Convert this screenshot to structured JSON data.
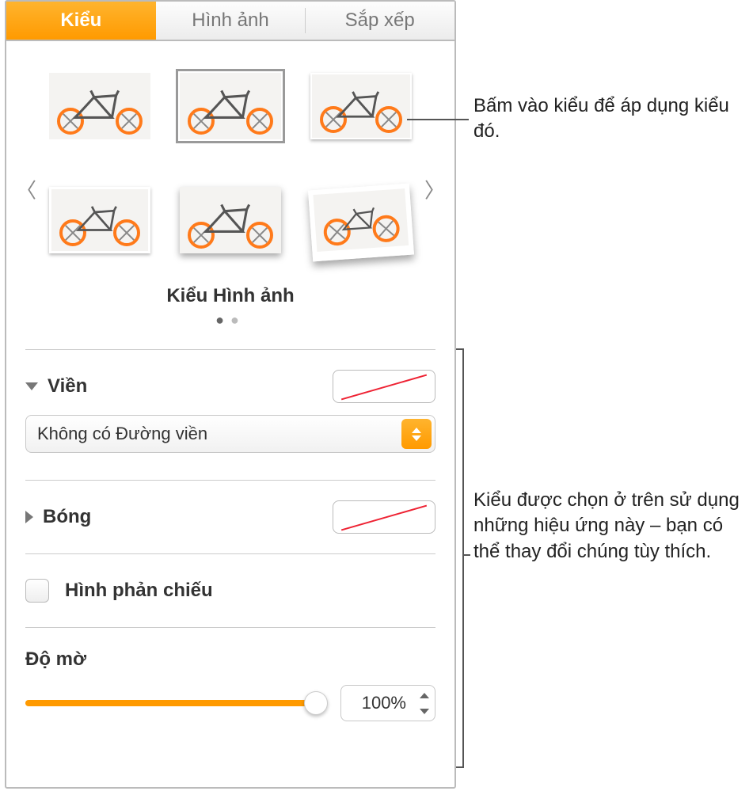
{
  "tabs": {
    "style": "Kiểu",
    "image": "Hình ảnh",
    "arrange": "Sắp xếp"
  },
  "gallery": {
    "title": "Kiểu Hình ảnh"
  },
  "border": {
    "label": "Viền",
    "dropdown": "Không có Đường viền"
  },
  "shadow": {
    "label": "Bóng"
  },
  "reflection": {
    "label": "Hình phản chiếu"
  },
  "opacity": {
    "label": "Độ mờ",
    "value": "100%"
  },
  "callouts": {
    "top": "Bấm vào kiểu để áp dụng kiểu đó.",
    "side": "Kiểu được chọn ở trên sử dụng những hiệu ứng này – bạn có thể thay đổi chúng tùy thích."
  }
}
